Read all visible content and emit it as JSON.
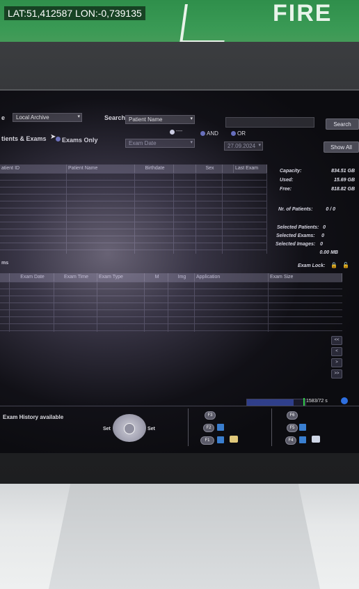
{
  "overlay": {
    "geo_tag": "LAT:51,412587 LON:-0,739135"
  },
  "colors": {
    "progress_fill": "#2f3f8c",
    "progress_marker": "#35d14a",
    "accent_icon": "#2e6fe0"
  },
  "toolbar": {
    "archive_label": "e",
    "archive_value": "Local Archive",
    "search_label": "Search",
    "search_field_value": "Patient Name",
    "search_input_value": "",
    "search_button": "Search",
    "show_all_button": "Show All",
    "mode_patients_exams": "tients & Exams",
    "mode_exams_only": "Exams Only",
    "radio_none": "----",
    "radio_and": "AND",
    "radio_or": "OR",
    "date_field": "Exam Date",
    "date_value": "27.09.2024"
  },
  "patient_table": {
    "columns": [
      "atient ID",
      "Patient Name",
      "Birthdate",
      "",
      "Sex",
      "",
      "Last Exam"
    ]
  },
  "stats": {
    "capacity_label": "Capacity:",
    "capacity_value": "834.51 GB",
    "used_label": "Used:",
    "used_value": "15.69 GB",
    "free_label": "Free:",
    "free_value": "818.82 GB",
    "patients_label": "Nr. of Patients:",
    "patients_value": "0 / 0",
    "sel_patients_label": "Selected Patients:",
    "sel_patients_value": "0",
    "sel_exams_label": "Selected Exams:",
    "sel_exams_value": "0",
    "sel_images_label": "Selected Images:",
    "sel_images_value": "0",
    "size_value": "0.00 MB"
  },
  "exam_section": {
    "title": "ms",
    "lock_label": "Exam Lock:",
    "columns": [
      "",
      "Exam Date",
      "Exam Time",
      "Exam Type",
      "M",
      "Img",
      "Application",
      "Exam Size"
    ]
  },
  "nav": {
    "first": "<<",
    "prev": "<",
    "next": ">",
    "last": ">>"
  },
  "status": {
    "history": "Exam History available",
    "progress_text": "1583/72 s",
    "progress_fraction": 0.8
  },
  "trackball": {
    "left_set": "Set",
    "right_set": "Set"
  },
  "fkeys": {
    "f3": "F3",
    "f2": "F2",
    "f1": "F1",
    "f6": "F6",
    "f5": "F5",
    "f4": "F4"
  }
}
